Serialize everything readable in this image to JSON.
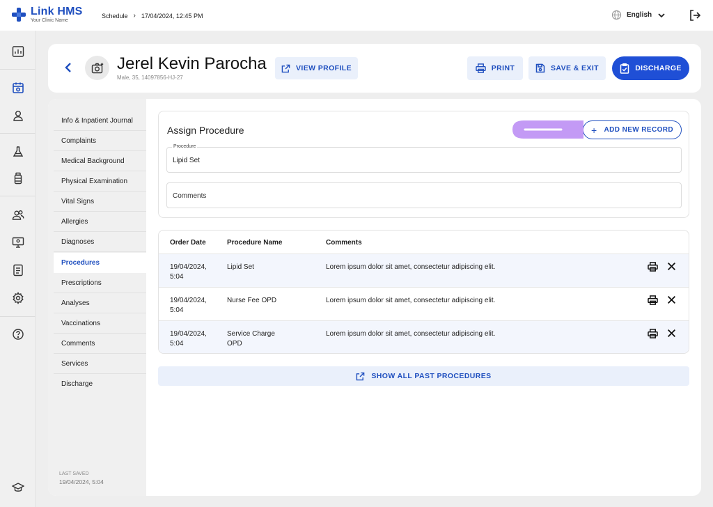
{
  "app": {
    "title": "Link HMS",
    "subtitle": "Your Clinic Name"
  },
  "breadcrumb": {
    "section": "Schedule",
    "current": "17/04/2024, 12:45 PM"
  },
  "language": {
    "selected": "English"
  },
  "rail": {
    "icons": [
      "dashboard-icon",
      "calendar-icon",
      "user-icon",
      "flask-icon",
      "bottle-icon",
      "users-icon",
      "monitor-icon",
      "document-icon",
      "settings-icon",
      "help-icon",
      "graduation-cap-icon"
    ],
    "active": "calendar-icon"
  },
  "patient": {
    "name": "Jerel Kevin Parocha",
    "meta": "Male, 35, 14097856-HJ-27"
  },
  "header_buttons": {
    "view_profile": "VIEW PROFILE",
    "print": "PRINT",
    "save_exit": "SAVE & EXIT",
    "discharge": "DISCHARGE"
  },
  "sidenav": {
    "items": [
      "Info & Inpatient Journal",
      "Complaints",
      "Medical Background",
      "Physical Examination",
      "Vital Signs",
      "Allergies",
      "Diagnoses",
      "Procedures",
      "Prescriptions",
      "Analyses",
      "Vaccinations",
      "Comments",
      "Services",
      "Discharge"
    ],
    "active": "Procedures",
    "last_saved_label": "LAST SAVED",
    "last_saved_value": "19/04/2024, 5:04"
  },
  "assign": {
    "title": "Assign Procedure",
    "add_button": "ADD NEW RECORD",
    "procedure_label": "Procedure",
    "procedure_value": "Lipid Set",
    "comments_placeholder": "Comments"
  },
  "table": {
    "columns": [
      "Order Date",
      "Procedure Name",
      "Comments"
    ],
    "rows": [
      {
        "date": "19/04/2024, 5:04",
        "name": "Lipid Set",
        "comment": "Lorem ipsum dolor sit amet, consectetur adipiscing elit."
      },
      {
        "date": "19/04/2024, 5:04",
        "name": "Nurse Fee OPD",
        "comment": "Lorem ipsum dolor sit amet, consectetur adipiscing elit."
      },
      {
        "date": "19/04/2024, 5:04",
        "name": "Service Charge OPD",
        "comment": "Lorem ipsum dolor sit amet, consectetur adipiscing elit."
      }
    ]
  },
  "show_all": "SHOW ALL PAST PROCEDURES",
  "colors": {
    "brand": "#1f4fbf",
    "primary": "#1f4fd6",
    "light": "#eaf0fb",
    "highlight_arrow": "#c39af5"
  }
}
